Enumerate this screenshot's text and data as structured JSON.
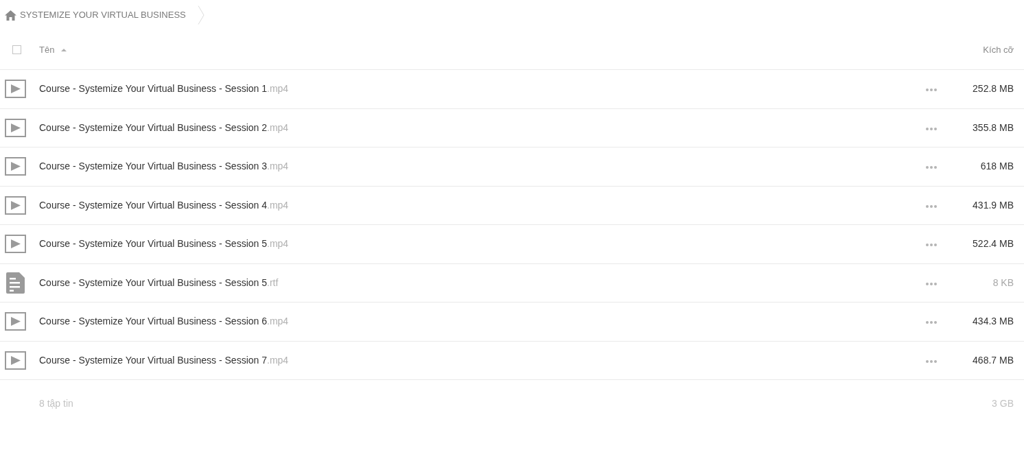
{
  "breadcrumb": {
    "items": [
      {
        "kind": "home",
        "label": "SYSTEMIZE YOUR VIRTUAL BUSINESS"
      }
    ]
  },
  "header": {
    "checked": false,
    "columns": [
      {
        "label": "Tên",
        "sorted": true
      },
      {
        "label": "Kích cỡ",
        "sorted": false
      }
    ]
  },
  "files": [
    {
      "kind": "video",
      "name": "Course - Systemize Your Virtual Business - Session 1",
      "extension": ".mp4",
      "size": "252.8 MB",
      "size_muted": false
    },
    {
      "kind": "video",
      "name": "Course - Systemize Your Virtual Business - Session 2",
      "extension": ".mp4",
      "size": "355.8 MB",
      "size_muted": false
    },
    {
      "kind": "video",
      "name": "Course - Systemize Your Virtual Business - Session 3",
      "extension": ".mp4",
      "size": "618 MB",
      "size_muted": false
    },
    {
      "kind": "video",
      "name": "Course - Systemize Your Virtual Business - Session 4",
      "extension": ".mp4",
      "size": "431.9 MB",
      "size_muted": false
    },
    {
      "kind": "video",
      "name": "Course - Systemize Your Virtual Business - Session 5",
      "extension": ".mp4",
      "size": "522.4 MB",
      "size_muted": false
    },
    {
      "kind": "document",
      "name": "Course - Systemize Your Virtual Business - Session 5",
      "extension": ".rtf",
      "size": "8 KB",
      "size_muted": true
    },
    {
      "kind": "video",
      "name": "Course - Systemize Your Virtual Business - Session 6",
      "extension": ".mp4",
      "size": "434.3 MB",
      "size_muted": false
    },
    {
      "kind": "video",
      "name": "Course - Systemize Your Virtual Business - Session 7",
      "extension": ".mp4",
      "size": "468.7 MB",
      "size_muted": false
    }
  ],
  "footer": {
    "count": "8 tập tin",
    "total": "3 GB"
  }
}
